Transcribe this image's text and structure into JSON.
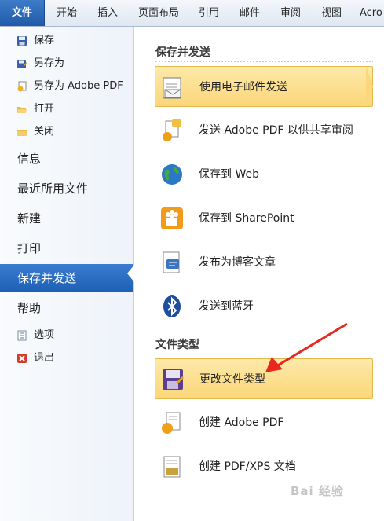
{
  "ribbon": {
    "tabs": [
      "文件",
      "开始",
      "插入",
      "页面布局",
      "引用",
      "邮件",
      "审阅",
      "视图",
      "Acro"
    ]
  },
  "leftnav": {
    "small_items_top": [
      {
        "label": "保存",
        "icon": "save-icon"
      },
      {
        "label": "另存为",
        "icon": "save-as-icon"
      },
      {
        "label": "另存为 Adobe PDF",
        "icon": "save-as-pdf-icon"
      },
      {
        "label": "打开",
        "icon": "open-folder-icon"
      },
      {
        "label": "关闭",
        "icon": "close-folder-icon"
      }
    ],
    "big_items": [
      "信息",
      "最近所用文件",
      "新建",
      "打印",
      "保存并发送",
      "帮助"
    ],
    "active_item": "保存并发送",
    "small_items_bottom": [
      {
        "label": "选项",
        "icon": "options-icon"
      },
      {
        "label": "退出",
        "icon": "exit-icon"
      }
    ]
  },
  "panel": {
    "section1_title": "保存并发送",
    "section1_items": [
      {
        "label": "使用电子邮件发送",
        "icon": "email-icon",
        "active": true
      },
      {
        "label": "发送 Adobe PDF 以供共享审阅",
        "icon": "pdf-review-icon"
      },
      {
        "label": "保存到 Web",
        "icon": "globe-icon"
      },
      {
        "label": "保存到 SharePoint",
        "icon": "sharepoint-icon"
      },
      {
        "label": "发布为博客文章",
        "icon": "blog-icon"
      },
      {
        "label": "发送到蓝牙",
        "icon": "bluetooth-icon"
      }
    ],
    "section2_title": "文件类型",
    "section2_items": [
      {
        "label": "更改文件类型",
        "icon": "change-filetype-icon",
        "active": true
      },
      {
        "label": "创建 Adobe PDF",
        "icon": "create-pdf-icon"
      },
      {
        "label": "创建 PDF/XPS 文档",
        "icon": "pdf-xps-icon"
      }
    ]
  },
  "watermark": "Bai 经验",
  "colors": {
    "accent": "#1d5fb4",
    "highlight": "#fbd67a",
    "arrow": "#e8271f"
  }
}
